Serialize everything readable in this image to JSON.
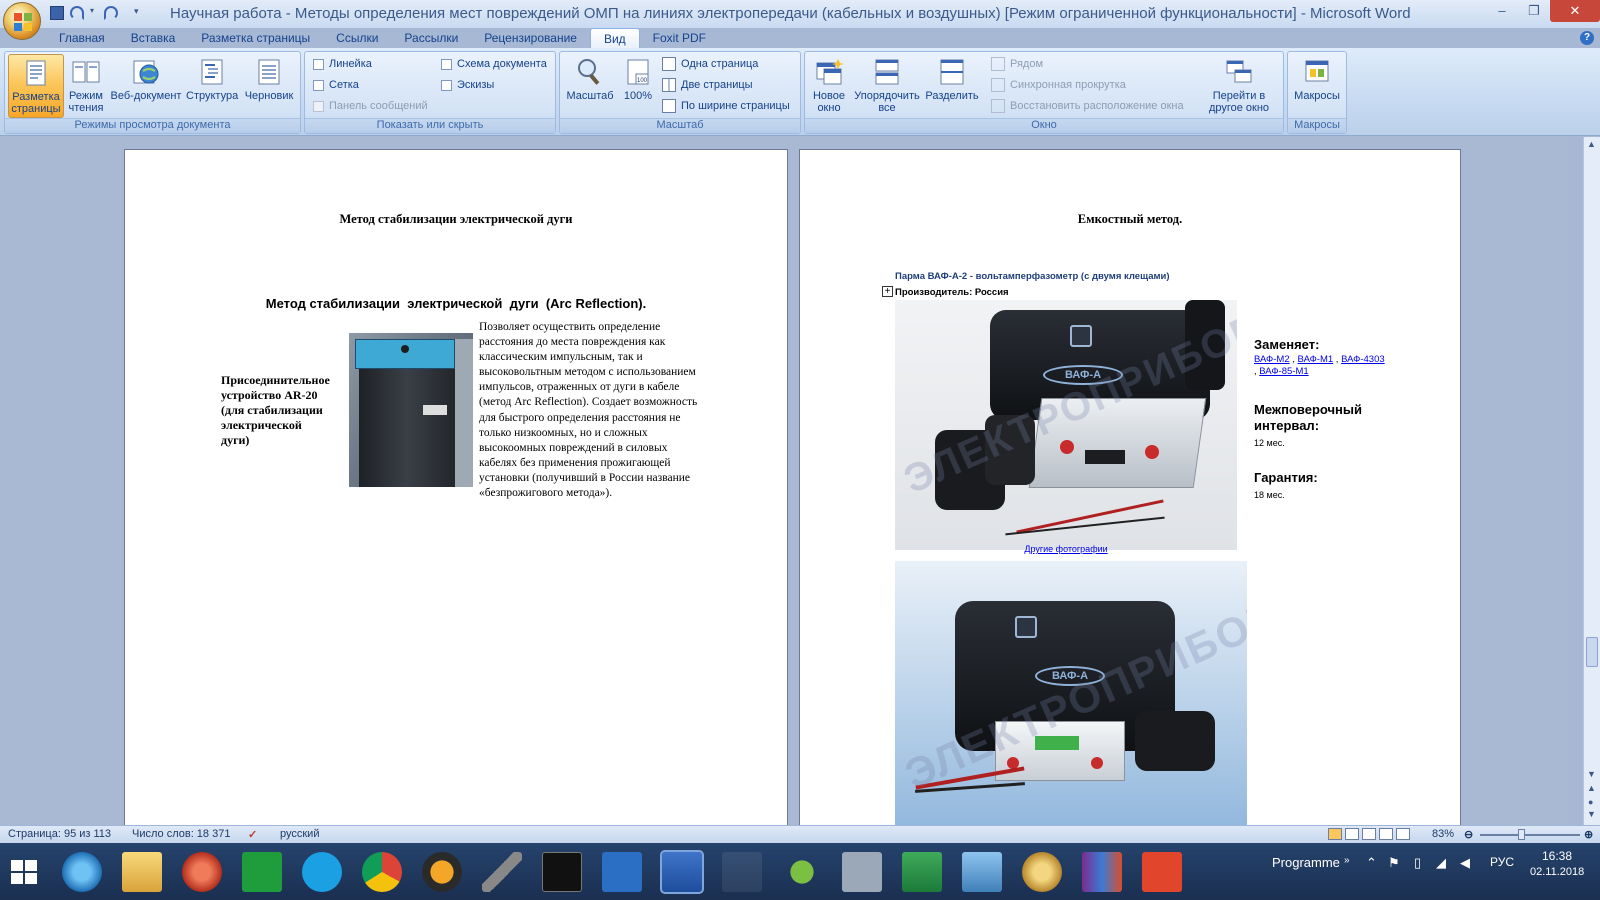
{
  "window": {
    "title": "Научная работа - Методы определения мест повреждений ОМП на линиях электропередачи (кабельных и воздушных) [Режим ограниченной функциональности] - Microsoft Word",
    "minimize": "–",
    "restore": "❐",
    "close": "✕"
  },
  "tabs": [
    "Главная",
    "Вставка",
    "Разметка страницы",
    "Ссылки",
    "Рассылки",
    "Рецензирование",
    "Вид",
    "Foxit PDF"
  ],
  "ribbon": {
    "views": {
      "label": "Режимы просмотра документа",
      "buttons": [
        "Разметка страницы",
        "Режим чтения",
        "Веб-документ",
        "Структура",
        "Черновик"
      ]
    },
    "show": {
      "label": "Показать или скрыть",
      "ruler": "Линейка",
      "grid": "Сетка",
      "messages": "Панель сообщений",
      "docmap": "Схема документа",
      "thumbs": "Эскизы"
    },
    "zoom": {
      "label": "Масштаб",
      "zoom_btn": "Масштаб",
      "percent_btn": "100%",
      "one_page": "Одна страница",
      "two_pages": "Две страницы",
      "page_width": "По ширине страницы"
    },
    "window_group": {
      "label": "Окно",
      "new_window": "Новое окно",
      "arrange_all": "Упорядочить все",
      "split": "Разделить",
      "side_by_side": "Рядом",
      "sync_scroll": "Синхронная прокрутка",
      "reset_pos": "Восстановить расположение окна",
      "switch": "Перейти в другое окно"
    },
    "macros": {
      "label": "Макросы",
      "button": "Макросы"
    }
  },
  "page_left": {
    "heading": "Метод стабилизации электрической дуги",
    "subheading": "Метод стабилизации  электрической  дуги  (Arc Reflection).",
    "caption_lines": [
      "Присоединительное",
      "устройство AR-20",
      "(для стабилизации",
      "электрической",
      "дуги)"
    ],
    "body_lines": [
      "Позволяет осуществить определение",
      "расстояния до места повреждения как",
      "классическим импульсным, так и",
      "высоковольтным методом с использованием",
      "импульсов, отраженных от дуги в кабеле",
      "(метод Arc  Reflection). Создает возможность",
      "для быстрого определения расстояния не",
      "только низкоомных, но и сложных",
      "высокоомных повреждений в силовых",
      "кабелях без применения прожигающей",
      "установки (получивший в России название",
      "«безпрожигового метода»)."
    ]
  },
  "page_right": {
    "heading": "Емкостный метод.",
    "product": "Парма ВАФ-А-2 - вольтамперфазометр (с двумя клещами)",
    "maker": "Производитель: Россия",
    "more_photos": "Другие фотографии",
    "watermark": "ЭЛЕКТРОПРИБОР",
    "device_label": "ВАФ-А",
    "replaces_label": "Заменяет:",
    "replaces_links": [
      "ВАФ-М2",
      "ВАФ-М1",
      "ВАФ-4303",
      "ВАФ-85-М1"
    ],
    "interval_label_1": "Межповерочный",
    "interval_label_2": "интервал:",
    "interval_value": "12 мес.",
    "warranty_label": "Гарантия:",
    "warranty_value": "18 мес."
  },
  "status": {
    "page": "Страница: 95 из 113",
    "words": "Число слов: 18 371",
    "lang": "русский",
    "zoom": "83%"
  },
  "taskbar": {
    "programme": "Programme",
    "lang": "РУС",
    "time": "16:38",
    "date": "02.11.2018"
  },
  "colors": {
    "accent": "#15428b",
    "ribbon_bg": "#c4d8f0",
    "taskbar_bg": "#1a2f50",
    "active_button": "#fbc75c"
  }
}
